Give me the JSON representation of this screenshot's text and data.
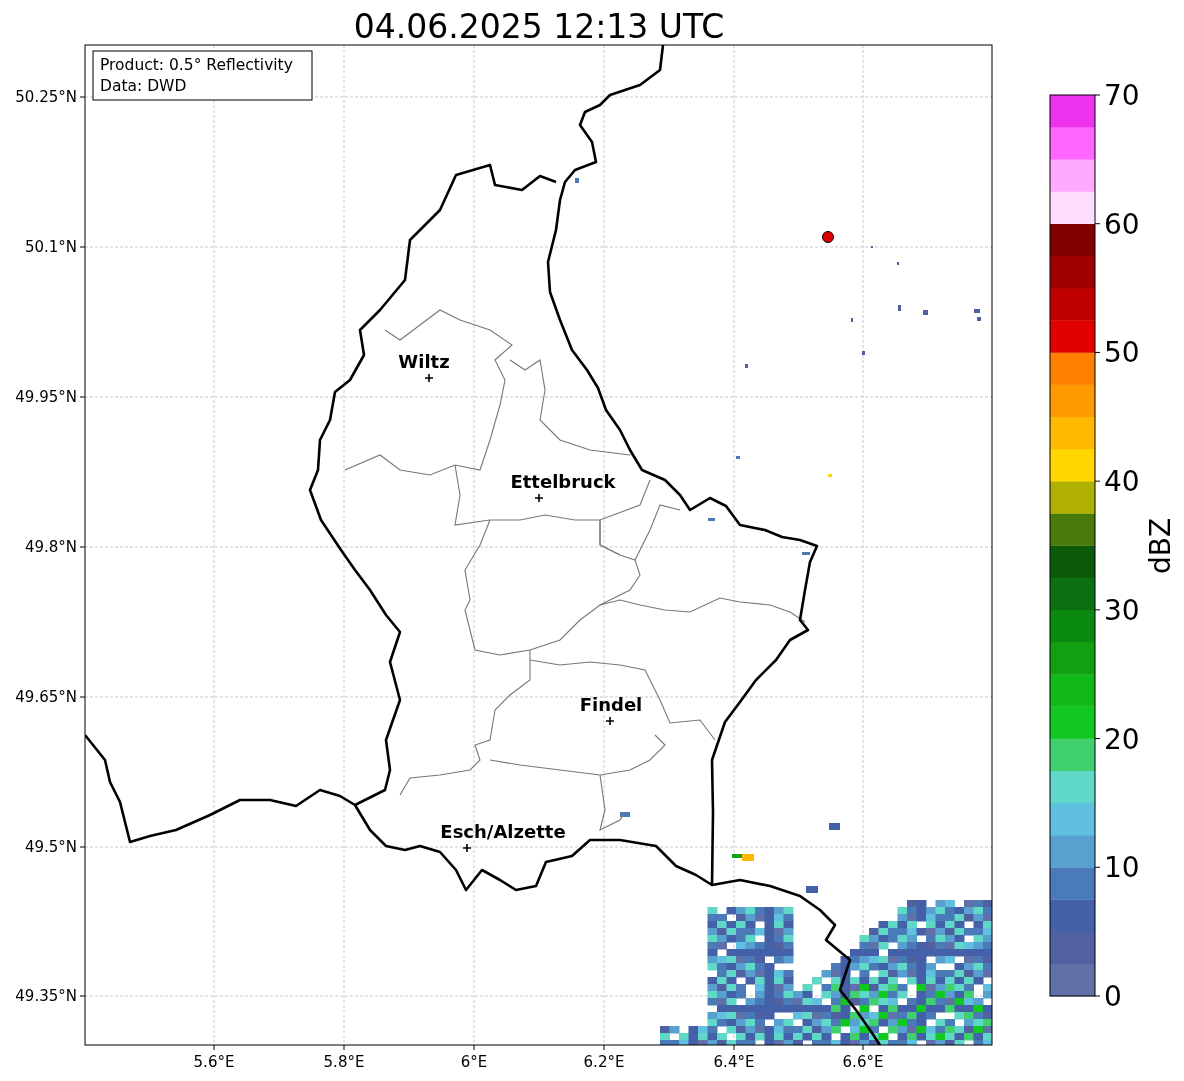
{
  "title": "04.06.2025 12:13 UTC",
  "info_box": [
    "Product: 0.5° Reflectivity",
    "Data: DWD"
  ],
  "lat_ticks": [
    "50.25°N",
    "50.1°N",
    "49.95°N",
    "49.8°N",
    "49.65°N",
    "49.5°N",
    "49.35°N"
  ],
  "lon_ticks": [
    "5.6°E",
    "5.8°E",
    "6°E",
    "6.2°E",
    "6.4°E",
    "6.6°E"
  ],
  "cities": [
    {
      "name": "Wiltz"
    },
    {
      "name": "Ettelbruck"
    },
    {
      "name": "Findel"
    },
    {
      "name": "Esch/Alzette"
    }
  ],
  "colorbar": {
    "label": "dBZ",
    "ticks": [
      "70",
      "60",
      "50",
      "40",
      "30",
      "20",
      "10",
      "0"
    ],
    "bands": [
      {
        "color": "#6070a8"
      },
      {
        "color": "#5060a0"
      },
      {
        "color": "#4460a8"
      },
      {
        "color": "#4a7ab8"
      },
      {
        "color": "#58a0d0"
      },
      {
        "color": "#60c0e0"
      },
      {
        "color": "#60d8c8"
      },
      {
        "color": "#40d070"
      },
      {
        "color": "#10c820"
      },
      {
        "color": "#10b818"
      },
      {
        "color": "#10a010"
      },
      {
        "color": "#0a8a10"
      },
      {
        "color": "#0a7010"
      },
      {
        "color": "#0a5a0a"
      },
      {
        "color": "#4a7a0a"
      },
      {
        "color": "#b0b000"
      },
      {
        "color": "#ffd700"
      },
      {
        "color": "#ffb800"
      },
      {
        "color": "#ff9900"
      },
      {
        "color": "#ff8000"
      },
      {
        "color": "#e00000"
      },
      {
        "color": "#c00000"
      },
      {
        "color": "#a00000"
      },
      {
        "color": "#800000"
      },
      {
        "color": "#ffddff"
      },
      {
        "color": "#ffaaff"
      },
      {
        "color": "#ff66ff"
      },
      {
        "color": "#ee33ee"
      }
    ]
  }
}
